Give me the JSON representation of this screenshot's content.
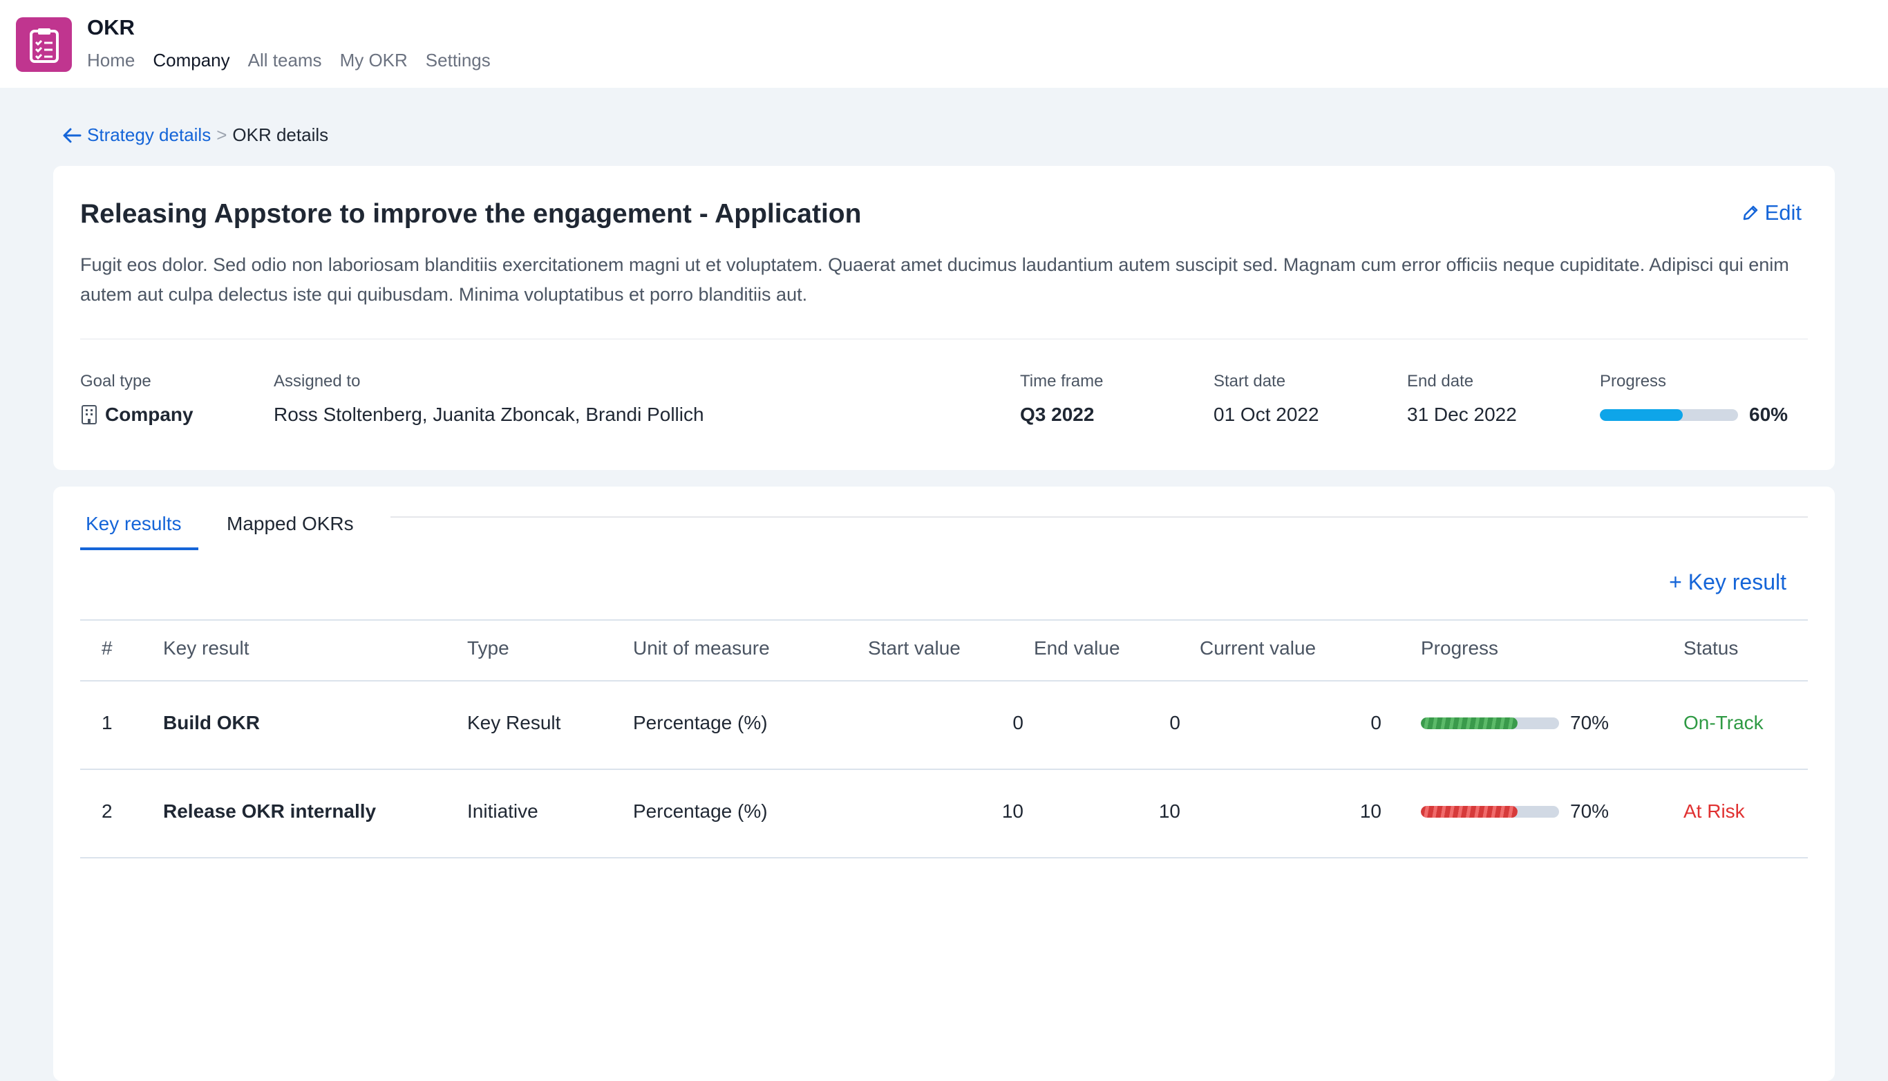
{
  "app": {
    "title": "OKR",
    "nav": [
      "Home",
      "Company",
      "All teams",
      "My OKR",
      "Settings"
    ],
    "active_nav": "Company"
  },
  "breadcrumb": {
    "parent": "Strategy details",
    "separator": ">",
    "current": "OKR details"
  },
  "okr": {
    "title": "Releasing Appstore to improve the engagement - Application",
    "edit_label": "Edit",
    "description": "Fugit eos dolor. Sed odio non laboriosam blanditiis exercitationem magni ut et voluptatem. Quaerat amet ducimus laudantium autem suscipit sed. Magnam cum error officiis neque cupiditate. Adipisci qui enim autem aut culpa delectus iste qui quibusdam. Minima voluptatibus et porro blanditiis aut.",
    "meta": {
      "goal_type_label": "Goal type",
      "goal_type": "Company",
      "assigned_label": "Assigned to",
      "assigned": "Ross Stoltenberg, Juanita Zboncak, Brandi Pollich",
      "timeframe_label": "Time frame",
      "timeframe": "Q3 2022",
      "start_label": "Start date",
      "start": "01 Oct 2022",
      "end_label": "End date",
      "end": "31 Dec 2022",
      "progress_label": "Progress",
      "progress_value": 0.6,
      "progress_text": "60%"
    }
  },
  "tabs": {
    "key_results": "Key results",
    "mapped": "Mapped OKRs",
    "active": "Key results"
  },
  "add_key_result": "+ Key result",
  "table": {
    "headers": {
      "num": "#",
      "key_result": "Key result",
      "type": "Type",
      "unit": "Unit of measure",
      "start": "Start value",
      "end": "End value",
      "current": "Current value",
      "progress": "Progress",
      "status": "Status"
    },
    "rows": [
      {
        "num": "1",
        "key_result": "Build OKR",
        "type": "Key Result",
        "unit": "Percentage (%)",
        "start": "0",
        "end": "0",
        "current": "0",
        "progress_value": 0.7,
        "progress_text": "70%",
        "status": "On-Track"
      },
      {
        "num": "2",
        "key_result": "Release OKR internally",
        "type": "Initiative",
        "unit": "Percentage (%)",
        "start": "10",
        "end": "10",
        "current": "10",
        "progress_value": 0.7,
        "progress_text": "70%",
        "status": "At Risk"
      }
    ]
  },
  "colors": {
    "brand": "#c0358f",
    "link": "#1565d8",
    "progress_main": "#0ea5e9",
    "on_track": "#2f9a44",
    "at_risk": "#e03131"
  }
}
